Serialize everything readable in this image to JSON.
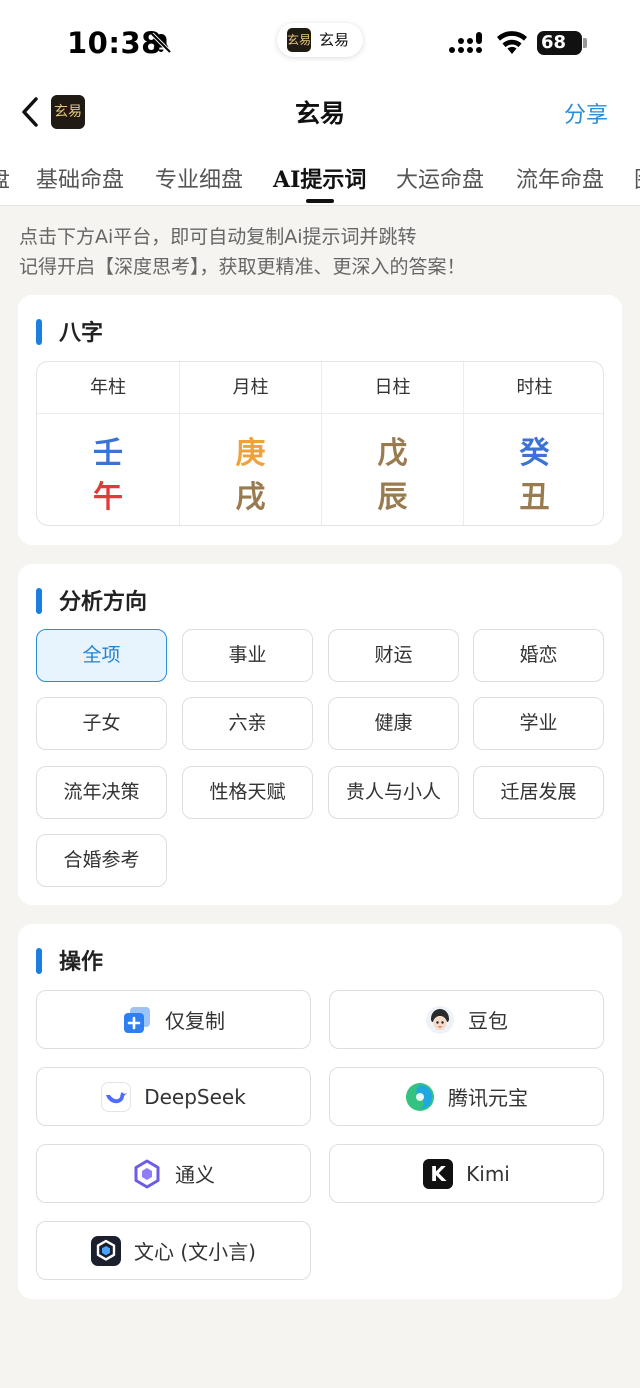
{
  "status_bar": {
    "time": "10:38",
    "battery": "68",
    "pill_label": "玄易",
    "pill_logo_text": "玄易"
  },
  "nav": {
    "title": "玄易",
    "logo_text": "玄易",
    "share": "分享"
  },
  "tabs": [
    {
      "label": "盘"
    },
    {
      "label": "基础命盘"
    },
    {
      "label": "专业细盘"
    },
    {
      "label": "AI提示词",
      "active": true
    },
    {
      "label": "大运命盘"
    },
    {
      "label": "流年命盘"
    },
    {
      "label": "图"
    }
  ],
  "hint": {
    "line1": "点击下方Ai平台，即可自动复制Ai提示词并跳转",
    "line2": "记得开启【深度思考】，获取更精准、更深入的答案！"
  },
  "bazi": {
    "title": "八字",
    "columns": [
      {
        "header": "年柱",
        "stem": "壬",
        "branch": "午",
        "stem_color": "#3a72d6",
        "branch_color": "#e03a3a"
      },
      {
        "header": "月柱",
        "stem": "庚",
        "branch": "戌",
        "stem_color": "#f0a23a",
        "branch_color": "#9a7b4f"
      },
      {
        "header": "日柱",
        "stem": "戊",
        "branch": "辰",
        "stem_color": "#9a7b4f",
        "branch_color": "#9a7b4f"
      },
      {
        "header": "时柱",
        "stem": "癸",
        "branch": "丑",
        "stem_color": "#3a72d6",
        "branch_color": "#9a7b4f"
      }
    ]
  },
  "analysis": {
    "title": "分析方向",
    "options": [
      {
        "label": "全项",
        "selected": true
      },
      {
        "label": "事业"
      },
      {
        "label": "财运"
      },
      {
        "label": "婚恋"
      },
      {
        "label": "子女"
      },
      {
        "label": "六亲"
      },
      {
        "label": "健康"
      },
      {
        "label": "学业"
      },
      {
        "label": "流年决策"
      },
      {
        "label": "性格天赋"
      },
      {
        "label": "贵人与小人"
      },
      {
        "label": "迁居发展"
      },
      {
        "label": "合婚参考"
      }
    ]
  },
  "actions": {
    "title": "操作",
    "buttons": [
      {
        "label": "仅复制",
        "icon": "copy-plus-icon"
      },
      {
        "label": "豆包",
        "icon": "doubao-icon"
      },
      {
        "label": "DeepSeek",
        "icon": "deepseek-icon"
      },
      {
        "label": "腾讯元宝",
        "icon": "yuanbao-icon"
      },
      {
        "label": "通义",
        "icon": "tongyi-icon"
      },
      {
        "label": "Kimi",
        "icon": "kimi-icon",
        "icon_text": "K"
      },
      {
        "label": "文心 (文小言)",
        "icon": "wenxin-icon"
      }
    ]
  },
  "colors": {
    "accent": "#2a8ed8",
    "title_bar": "#1a7fe0",
    "background": "#f5f4f0"
  }
}
